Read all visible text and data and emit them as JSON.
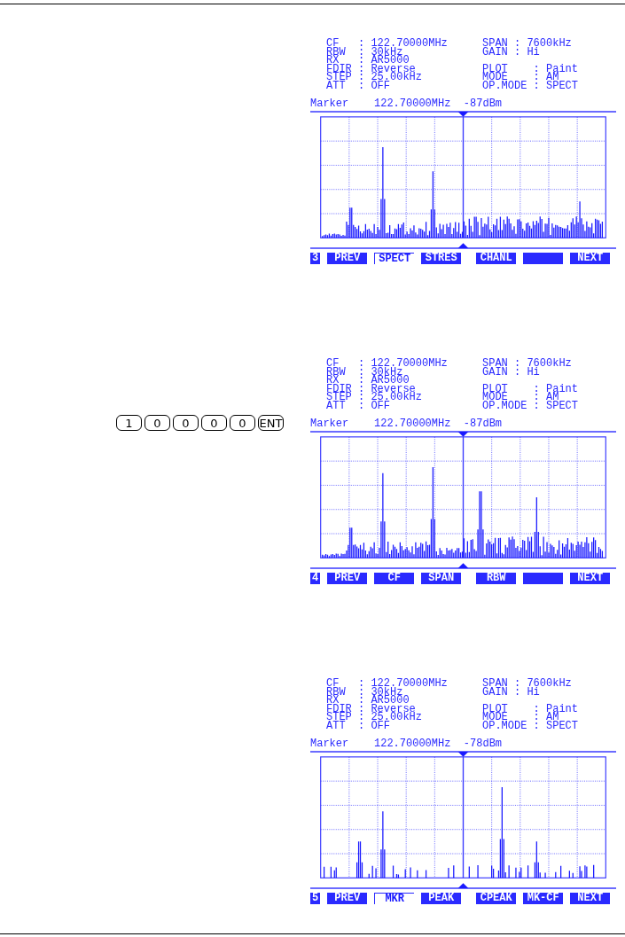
{
  "screens": [
    {
      "info_rows": [
        {
          "left": "CF   : 122.70000MHz",
          "right": "SPAN : 7600kHz"
        },
        {
          "left": "RBW  : 30kHz",
          "right": "GAIN : Hi"
        },
        {
          "left": "RX   : AR5000"
        },
        {
          "left": "FDIR : Reverse",
          "right": "PLOT    : Paint"
        },
        {
          "left": "STEP : 25.00kHz",
          "right": "MODE    : AM"
        },
        {
          "left": "ATT  : OFF",
          "right": "OP.MODE : SPECT"
        }
      ],
      "marker": "Marker    122.70000MHz  -87dBm",
      "page": "3",
      "softkeys": [
        {
          "label": "PREV",
          "selected": false
        },
        {
          "label": "SPECT",
          "selected": true
        },
        {
          "label": "STRES",
          "selected": false
        },
        {
          "label": "CHANL",
          "selected": false
        },
        {
          "selected": false
        },
        {
          "label": "NEXT",
          "selected": false
        }
      ]
    },
    {
      "keypad": [
        "1",
        "0",
        "0",
        "0",
        "0",
        "ENT"
      ],
      "info_rows": [
        {
          "left": "CF   : 122.70000MHz",
          "right": "SPAN : 7600kHz"
        },
        {
          "left": "RBW  : 30kHz",
          "right": "GAIN : Hi"
        },
        {
          "left": "RX   : AR5000"
        },
        {
          "left": "FDIR : Reverse",
          "right": "PLOT    : Paint"
        },
        {
          "left": "STEP : 25.00kHz",
          "right": "MODE    : AM"
        },
        {
          "left": "ATT  : OFF",
          "right": "OP.MODE : SPECT"
        }
      ],
      "marker": "Marker    122.70000MHz  -87dBm",
      "page": "4",
      "softkeys": [
        {
          "label": "PREV",
          "selected": false
        },
        {
          "label": "CF",
          "selected": false
        },
        {
          "label": "SPAN",
          "selected": false
        },
        {
          "label": "RBW",
          "selected": false
        },
        {
          "selected": false
        },
        {
          "label": "NEXT",
          "selected": false
        }
      ]
    },
    {
      "info_rows": [
        {
          "left": "CF   : 122.70000MHz",
          "right": "SPAN : 7600kHz"
        },
        {
          "left": "RBW  : 30kHz",
          "right": "GAIN : Hi"
        },
        {
          "left": "RX   : AR5000"
        },
        {
          "left": "FDIR : Reverse",
          "right": "PLOT    : Paint"
        },
        {
          "left": "STEP : 25.00kHz",
          "right": "MODE    : AM"
        },
        {
          "left": "ATT  : OFF",
          "right": "OP.MODE : SPECT"
        }
      ],
      "marker": "Marker    122.70000MHz  -78dBm",
      "page": "5",
      "softkeys": [
        {
          "label": "PREV",
          "selected": false
        },
        {
          "label": "MKR",
          "selected": true
        },
        {
          "label": "PEAK",
          "selected": false
        },
        {
          "label": "CPEAK",
          "selected": false
        },
        {
          "label": "MK-CF",
          "selected": false
        },
        {
          "label": "NEXT",
          "selected": false
        }
      ]
    }
  ]
}
